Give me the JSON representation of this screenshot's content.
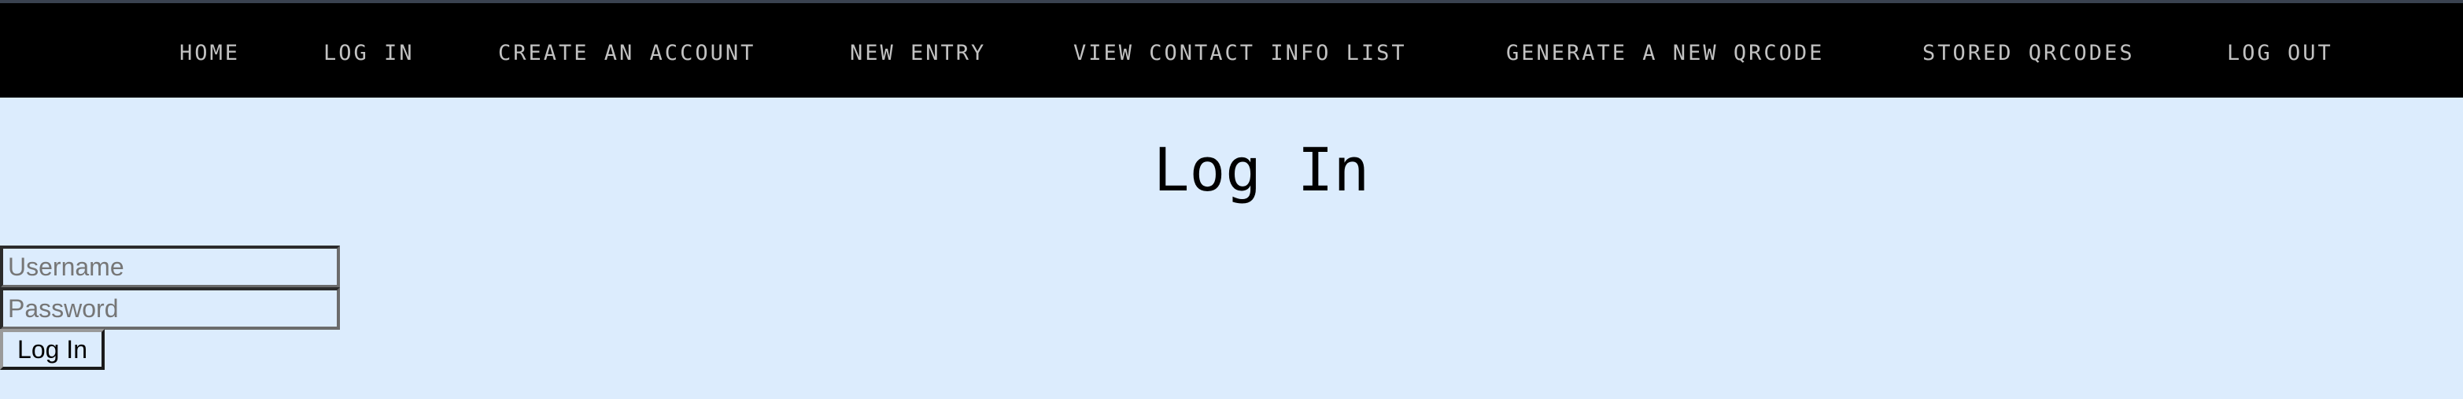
{
  "nav": {
    "items": [
      {
        "label": "HOME"
      },
      {
        "label": "LOG IN"
      },
      {
        "label": "CREATE AN ACCOUNT"
      },
      {
        "label": "NEW ENTRY"
      },
      {
        "label": "VIEW CONTACT INFO LIST"
      },
      {
        "label": "GENERATE A NEW QRCODE"
      },
      {
        "label": "STORED QRCODES"
      },
      {
        "label": "LOG OUT"
      }
    ]
  },
  "page": {
    "title": "Log In"
  },
  "form": {
    "username_placeholder": "Username",
    "username_value": "",
    "password_placeholder": "Password",
    "password_value": "",
    "submit_label": "Log In"
  },
  "colors": {
    "nav_background": "#000000",
    "nav_text": "#c2c2c2",
    "page_background": "#dcecfd",
    "title_text": "#000000"
  }
}
